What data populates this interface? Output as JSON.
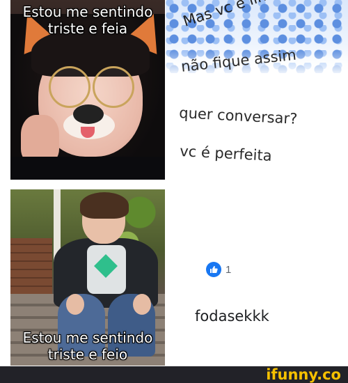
{
  "top_left_panel": {
    "caption_line1": "Estou me sentindo",
    "caption_line2": "triste e feia"
  },
  "comment": {
    "line1": "Mas vc é linda!",
    "line2": "não fique assim",
    "line3": "quer conversar?",
    "line4": "vc é perfeita"
  },
  "bottom_left_panel": {
    "caption_line1": "Estou me sentindo",
    "caption_line2": "triste e feio"
  },
  "reaction": {
    "icon": "thumbs-up-icon",
    "count": "1",
    "color": "#1877f2"
  },
  "reply": {
    "text": "fodasekkk"
  },
  "watermark": {
    "text": "ifunny.co",
    "color": "#f5c000"
  }
}
